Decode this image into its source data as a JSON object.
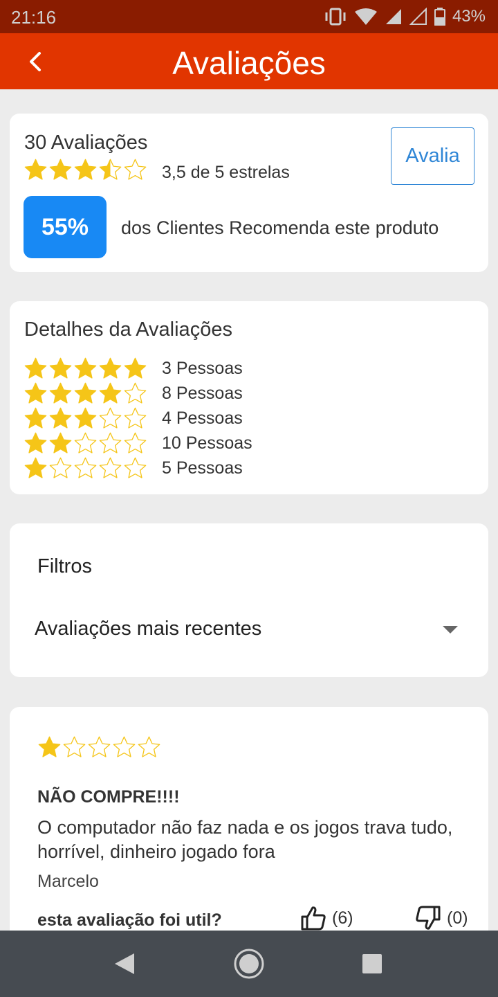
{
  "status_bar": {
    "time": "21:16",
    "battery": "43%"
  },
  "app_bar": {
    "title": "Avaliações",
    "back_icon": "back-chevron-icon"
  },
  "summary": {
    "count_label": "30 Avaliações",
    "rating_value": 3.5,
    "rating_text": "3,5 de 5 estrelas",
    "rate_button": "Avalia",
    "recommend_percent": "55%",
    "recommend_text": "dos Clientes Recomenda este produto"
  },
  "details": {
    "title": "Detalhes da Avaliações",
    "rows": [
      {
        "stars": 5,
        "count": "3 Pessoas"
      },
      {
        "stars": 4,
        "count": "8 Pessoas"
      },
      {
        "stars": 3,
        "count": "4 Pessoas"
      },
      {
        "stars": 2,
        "count": "10 Pessoas"
      },
      {
        "stars": 1,
        "count": "5 Pessoas"
      }
    ]
  },
  "filters": {
    "label": "Filtros",
    "selected": "Avaliações mais recentes"
  },
  "review": {
    "stars": 1,
    "title": "NÃO COMPRE!!!!",
    "body": "O computador não faz nada e os jogos trava tudo, horrível, dinheiro jogado fora",
    "author": "Marcelo",
    "helpful_question": "esta avaliação foi util?",
    "up_count": "(6)",
    "down_count": "(0)"
  },
  "colors": {
    "status_bar": "#8a1c00",
    "app_bar": "#e13500",
    "star": "#f5c518",
    "badge": "#1889f4",
    "link": "#2f86d6",
    "nav_bar": "#464b51"
  }
}
